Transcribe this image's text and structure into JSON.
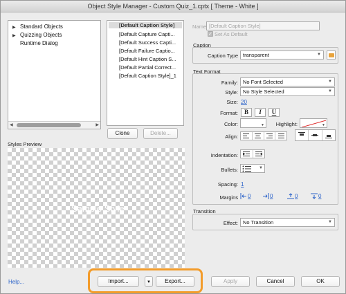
{
  "window": {
    "title": "Object Style Manager - Custom Quiz_1.cptx [ Theme - White ]"
  },
  "tree": {
    "items": [
      {
        "label": "Standard Objects",
        "expandable": true
      },
      {
        "label": "Quizzing Objects",
        "expandable": true
      },
      {
        "label": "Runtime Dialog",
        "expandable": false
      }
    ]
  },
  "style_list": {
    "items": [
      "[Default Caption Style]",
      "[Default Capture Capti...",
      "[Default Success Capti...",
      "[Default Failure Captio...",
      "[Default Hint Caption S...",
      "[Default Partial Correct...",
      "[Default Caption Style]_1"
    ],
    "selected_index": 0
  },
  "list_buttons": {
    "clone": "Clone",
    "delete": "Delete..."
  },
  "styles_preview": {
    "label": "Styles Preview",
    "sample_text": "Sample Style"
  },
  "name_section": {
    "label": "Name",
    "value": "[Default Caption Style]",
    "set_default_label": "Set As Default",
    "set_default_checked": true
  },
  "caption_section": {
    "label": "Caption",
    "type_label": "Caption Type",
    "type_value": "transparent"
  },
  "text_format": {
    "label": "Text Format",
    "family_label": "Family:",
    "family_value": "No Font Selected",
    "style_label": "Style:",
    "style_value": "No Style Selected",
    "size_label": "Size:",
    "size_value": "20",
    "format_label": "Format:",
    "bold": "B",
    "italic": "I",
    "underline": "U",
    "color_label": "Color:",
    "highlight_label": "Highlight:",
    "align_label": "Align:",
    "indentation_label": "Indentation:",
    "bullets_label": "Bullets:",
    "spacing_label": "Spacing:",
    "spacing_value": "1",
    "margins_label": "Margins",
    "margins": [
      "0",
      "0",
      "0",
      "0"
    ]
  },
  "transition_section": {
    "label": "Transition",
    "effect_label": "Effect:",
    "effect_value": "No Transition"
  },
  "footer": {
    "help": "Help...",
    "import": "Import...",
    "export": "Export...",
    "apply": "Apply",
    "cancel": "Cancel",
    "ok": "OK"
  },
  "colors": {
    "accent_highlight": "#f39c2b",
    "link": "#2a62c9"
  }
}
